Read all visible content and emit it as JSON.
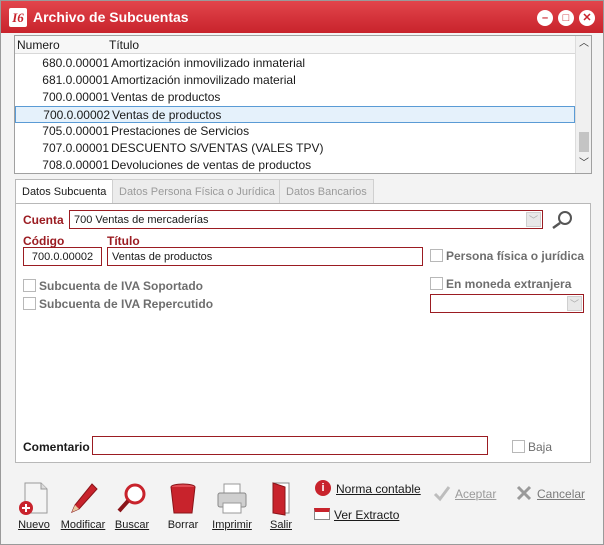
{
  "window": {
    "title": "Archivo de Subcuentas",
    "logo_text": "I6",
    "controls": [
      "minimize",
      "maximize",
      "close"
    ]
  },
  "list": {
    "columns": [
      "Numero",
      "Título"
    ],
    "rows": [
      {
        "num": "680.0.00001",
        "title": "Amortización inmovilizado inmaterial"
      },
      {
        "num": "681.0.00001",
        "title": "Amortización inmovilizado material"
      },
      {
        "num": "700.0.00001",
        "title": "Ventas de productos"
      },
      {
        "num": "700.0.00002",
        "title": "Ventas de productos",
        "selected": true
      },
      {
        "num": "705.0.00001",
        "title": "Prestaciones de Servicios"
      },
      {
        "num": "707.0.00001",
        "title": "DESCUENTO S/VENTAS (VALES TPV)"
      },
      {
        "num": "708.0.00001",
        "title": "Devoluciones de ventas de productos"
      }
    ]
  },
  "tabs": [
    {
      "label": "Datos Subcuenta",
      "active": true
    },
    {
      "label": "Datos Persona Física o Jurídica",
      "active": false
    },
    {
      "label": "Datos Bancarios",
      "active": false
    }
  ],
  "form": {
    "cuenta_label": "Cuenta",
    "cuenta_value": "700   Ventas de mercaderías",
    "codigo_label": "Código",
    "codigo_value": "700.0.00002",
    "titulo_label": "Título",
    "titulo_value": "Ventas de productos",
    "persona_label": "Persona física o jurídica",
    "iva_soportado_label": "Subcuenta de IVA Soportado",
    "iva_repercutido_label": "Subcuenta de IVA Repercutido",
    "moneda_label": "En moneda extranjera",
    "moneda_value": "",
    "comentario_label": "Comentario",
    "comentario_value": "",
    "baja_label": "Baja"
  },
  "toolbar": {
    "nuevo": "Nuevo",
    "modificar": "Modificar",
    "buscar": "Buscar",
    "borrar": "Borrar",
    "imprimir": "Imprimir",
    "salir": "Salir",
    "norma_contable": "Norma contable",
    "ver_extracto": "Ver Extracto",
    "aceptar": "Aceptar",
    "cancelar": "Cancelar"
  },
  "colors": {
    "accent": "#c8232c",
    "field_border": "#9b1c22",
    "selection": "#e5f1fb"
  }
}
